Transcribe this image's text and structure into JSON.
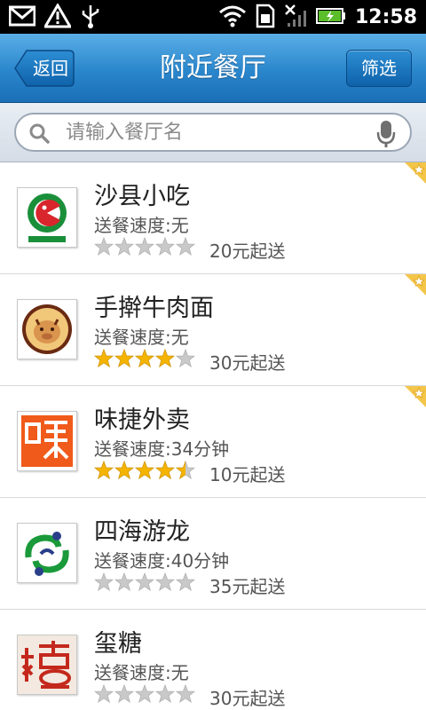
{
  "status_bar": {
    "time": "12:58"
  },
  "header": {
    "back_label": "返回",
    "title": "附近餐厅",
    "filter_label": "筛选"
  },
  "search": {
    "placeholder": "请输入餐厅名"
  },
  "colors": {
    "header_blue": "#2a86cc",
    "star_gold": "#f5b400",
    "star_gray": "#c9c9c9"
  },
  "restaurants": [
    {
      "name": "沙县小吃",
      "speed": "送餐速度:无",
      "rating": 0,
      "min_order": "20元起送",
      "logo": "shaxian-logo",
      "featured": true
    },
    {
      "name": "手擀牛肉面",
      "speed": "送餐速度:无",
      "rating": 4,
      "min_order": "30元起送",
      "logo": "beef-noodle-logo",
      "featured": true
    },
    {
      "name": "味捷外卖",
      "speed": "送餐速度:34分钟",
      "rating": 4.5,
      "min_order": "10元起送",
      "logo": "weijie-logo",
      "featured": true
    },
    {
      "name": "四海游龙",
      "speed": "送餐速度:40分钟",
      "rating": 0,
      "min_order": "35元起送",
      "logo": "sihai-logo",
      "featured": false
    },
    {
      "name": "玺糖",
      "speed": "送餐速度:无",
      "rating": 0,
      "min_order": "30元起送",
      "logo": "xitang-logo",
      "featured": false
    }
  ]
}
